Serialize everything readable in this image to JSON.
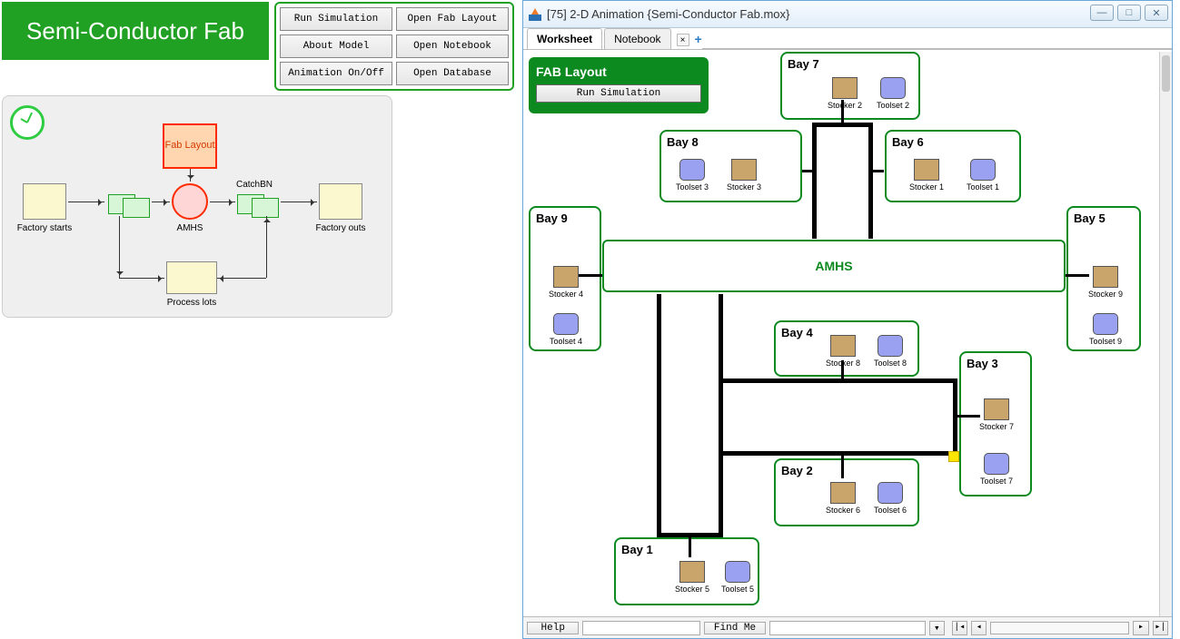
{
  "app_title": "Semi-Conductor Fab",
  "buttons": {
    "run_sim": "Run Simulation",
    "open_layout": "Open Fab Layout",
    "about": "About Model",
    "open_nb": "Open Notebook",
    "anim": "Animation On/Off",
    "open_db": "Open Database"
  },
  "model": {
    "fab_layout": "Fab\nLayout",
    "amhs": "AMHS",
    "catch": "CatchBN",
    "factory_starts": "Factory starts",
    "factory_outs": "Factory outs",
    "process_lots": "Process lots"
  },
  "window": {
    "title": "[75] 2-D Animation {Semi-Conductor Fab.mox}",
    "tab_worksheet": "Worksheet",
    "tab_notebook": "Notebook"
  },
  "fab_panel": {
    "title": "FAB Layout",
    "run": "Run Simulation"
  },
  "amhs_label": "AMHS",
  "bays": {
    "b1": {
      "title": "Bay 1",
      "stocker": "Stocker 5",
      "toolset": "Toolset 5"
    },
    "b2": {
      "title": "Bay 2",
      "stocker": "Stocker 6",
      "toolset": "Toolset 6"
    },
    "b3": {
      "title": "Bay 3",
      "stocker": "Stocker 7",
      "toolset": "Toolset 7"
    },
    "b4": {
      "title": "Bay 4",
      "stocker": "Stocker 8",
      "toolset": "Toolset 8"
    },
    "b5": {
      "title": "Bay 5",
      "stocker": "Stocker 9",
      "toolset": "Toolset 9"
    },
    "b6": {
      "title": "Bay 6",
      "stocker": "Stocker 1",
      "toolset": "Toolset 1"
    },
    "b7": {
      "title": "Bay 7",
      "stocker": "Stocker 2",
      "toolset": "Toolset 2"
    },
    "b8": {
      "title": "Bay 8",
      "stocker": "Stocker 3",
      "toolset": "Toolset 3"
    },
    "b9": {
      "title": "Bay 9",
      "stocker": "Stocker 4",
      "toolset": "Toolset 4"
    }
  },
  "status": {
    "help": "Help",
    "find": "Find Me"
  }
}
